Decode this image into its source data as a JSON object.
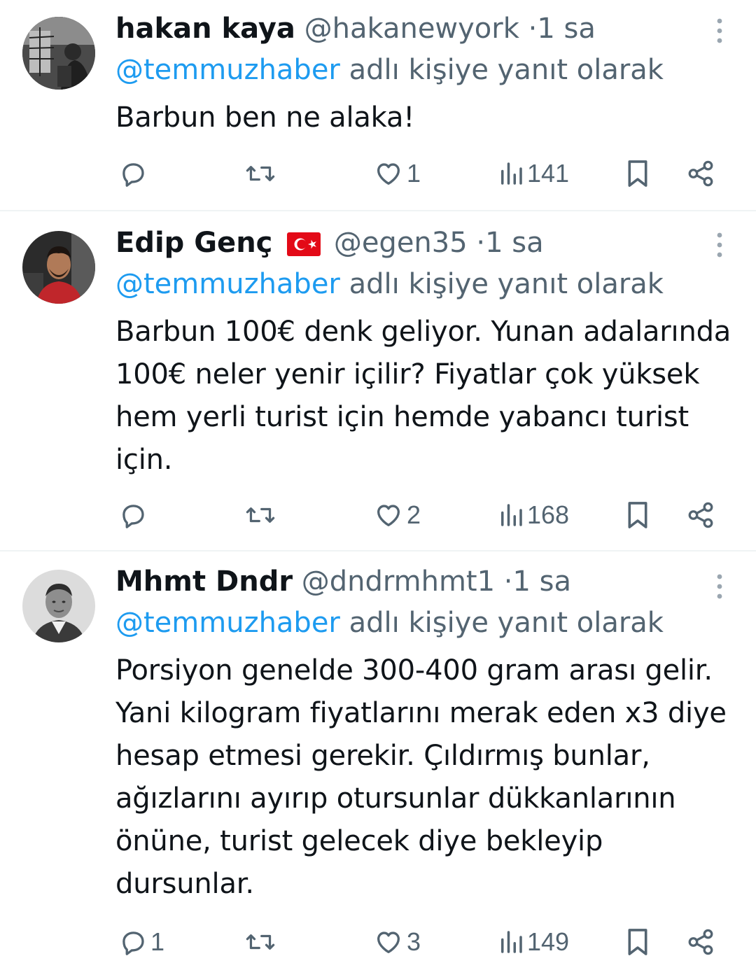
{
  "tweets": [
    {
      "name": "hakan kaya",
      "handle": "@hakanewyork",
      "separator": "·",
      "time": "1 sa",
      "reply_mention": "@temmuzhaber",
      "reply_suffix": "adlı kişiye yanıt olarak",
      "text": "Barbun ben ne alaka!",
      "replies": "",
      "retweets": "",
      "likes": "1",
      "views": "141"
    },
    {
      "name": "Edip Genç",
      "handle": "@egen35",
      "separator": "·",
      "time": "1 sa",
      "reply_mention": "@temmuzhaber",
      "reply_suffix": "adlı kişiye yanıt olarak",
      "text": "Barbun 100€ denk geliyor. Yunan adalarında 100€ neler yenir içilir? Fiyatlar çok yüksek hem yerli turist için hemde yabancı turist için.",
      "replies": "",
      "retweets": "",
      "likes": "2",
      "views": "168"
    },
    {
      "name": "Mhmt Dndr",
      "handle": "@dndrmhmt1",
      "separator": "·",
      "time": "1 sa",
      "reply_mention": "@temmuzhaber",
      "reply_suffix": "adlı kişiye yanıt olarak",
      "text": "Porsiyon genelde 300-400 gram arası gelir. Yani kilogram fiyatlarını merak eden x3 diye hesap etmesi gerekir. Çıldırmış bunlar, ağızlarını ayırıp otursunlar dükkanlarının önüne, turist gelecek diye bekleyip dursunlar.",
      "replies": "1",
      "retweets": "",
      "likes": "3",
      "views": "149"
    }
  ],
  "icons": {
    "reply": "reply-icon",
    "retweet": "retweet-icon",
    "like": "heart-icon",
    "views": "views-icon",
    "bookmark": "bookmark-icon",
    "share": "share-icon",
    "more": "more-vertical-icon"
  },
  "colors": {
    "text": "#0f1419",
    "secondary": "#536471",
    "accent": "#1d9bf0",
    "divider": "#eff3f4",
    "flag_red": "#e30a17"
  }
}
